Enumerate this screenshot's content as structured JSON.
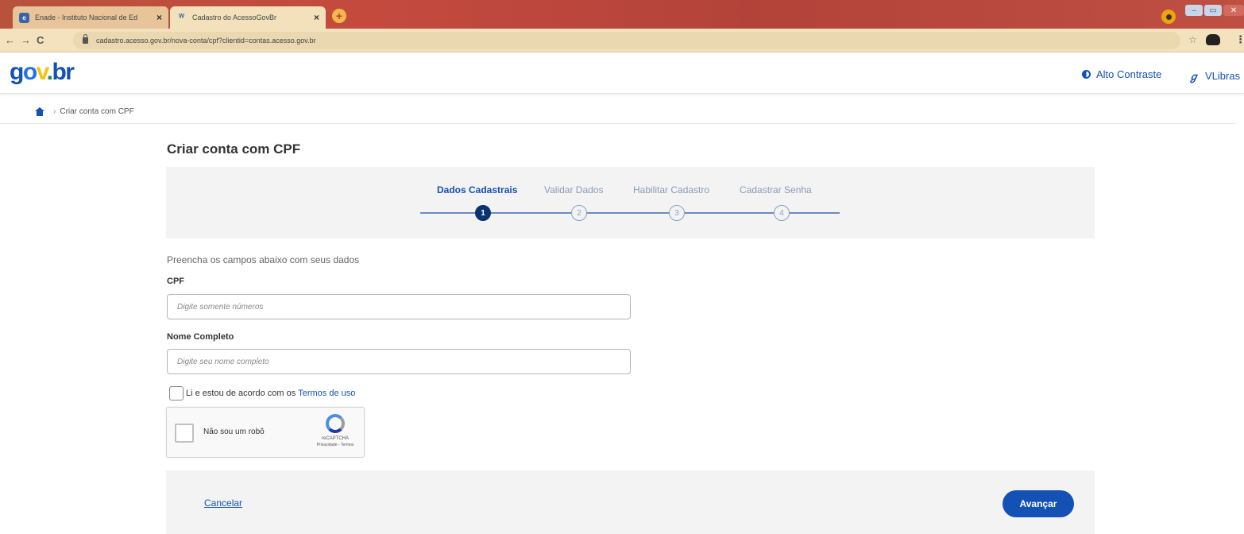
{
  "browser": {
    "tabs": [
      {
        "title": "Enade - Instituto Nacional de Ed",
        "favicon": "inep-icon",
        "close": "×",
        "active": false
      },
      {
        "title": "Cadastro do AcessoGovBr",
        "favicon": "govbr-icon",
        "close": "×",
        "active": true
      }
    ],
    "new_tab": "+",
    "url": "cadastro.acesso.gov.br/nova-conta/cpf?clientid=contas.acesso.gov.br",
    "nav": {
      "back": "←",
      "forward": "→",
      "reload": "C"
    },
    "star": "☆",
    "menu": "⋮",
    "window_controls": {
      "minimize": "–",
      "maximize": "▭",
      "close": "✕"
    }
  },
  "header": {
    "logo": {
      "g1": "g",
      "g2": "o",
      "g3": "v",
      "g4": ".",
      "g5": "br"
    },
    "contrast_label": "Alto Contraste",
    "vlibras_label": "VLibras",
    "vlibras_glyph": "ℊ"
  },
  "breadcrumb": {
    "separator": "›",
    "current": "Criar conta com CPF"
  },
  "page": {
    "title": "Criar conta com CPF",
    "steps": [
      {
        "label": "Dados Cadastrais",
        "number": "1",
        "active": true
      },
      {
        "label": "Validar Dados",
        "number": "2",
        "active": false
      },
      {
        "label": "Habilitar Cadastro",
        "number": "3",
        "active": false
      },
      {
        "label": "Cadastrar Senha",
        "number": "4",
        "active": false
      }
    ],
    "instructions": "Preencha os campos abaixo com seus dados",
    "cpf": {
      "label": "CPF",
      "placeholder": "Digite somente números",
      "value": ""
    },
    "nome": {
      "label": "Nome Completo",
      "placeholder": "Digite seu nome completo",
      "value": ""
    },
    "terms": {
      "text": "Li e estou de acordo com os",
      "link": "Termos de uso"
    },
    "recaptcha": {
      "label": "Não sou um robô",
      "brand": "reCAPTCHA",
      "links": "Privacidade - Termos"
    },
    "cancel_label": "Cancelar",
    "next_label": "Avançar"
  },
  "colors": {
    "primary": "#1351b4",
    "step_active": "#0c326f",
    "panel_bg": "#f3f3f3"
  }
}
